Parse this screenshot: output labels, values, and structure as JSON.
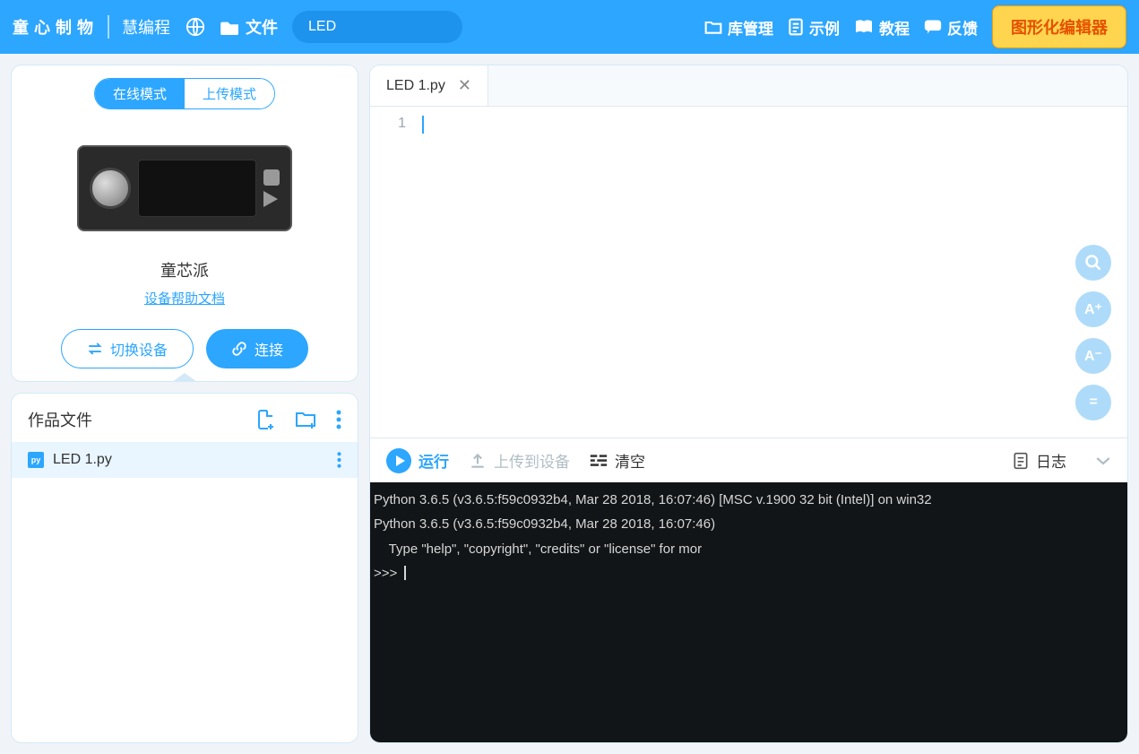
{
  "brand": "童心制物",
  "brand_sub": "慧编程",
  "file_menu": "文件",
  "search_value": "LED",
  "nav": {
    "library": "库管理",
    "examples": "示例",
    "tutorials": "教程",
    "feedback": "反馈"
  },
  "cta": "图形化编辑器",
  "modes": {
    "online": "在线模式",
    "upload": "上传模式"
  },
  "device": {
    "name": "童芯派",
    "help": "设备帮助文档",
    "switch": "切换设备",
    "connect": "连接"
  },
  "files_title": "作品文件",
  "files": [
    {
      "name": "LED 1.py"
    }
  ],
  "tab": {
    "name": "LED 1.py"
  },
  "editor": {
    "line_number": "1"
  },
  "float": {
    "a_plus": "A⁺",
    "a_minus": "A⁻",
    "equals": "="
  },
  "toolbar": {
    "run": "运行",
    "upload": "上传到设备",
    "clear": "清空",
    "log": "日志"
  },
  "terminal": {
    "line1": "Python 3.6.5 (v3.6.5:f59c0932b4, Mar 28 2018, 16:07:46) [MSC v.1900 32 bit (Intel)] on win32",
    "line2": "Python 3.6.5 (v3.6.5:f59c0932b4, Mar 28 2018, 16:07:46)",
    "line3": "    Type \"help\", \"copyright\", \"credits\" or \"license\" for mor",
    "prompt": ">>> "
  }
}
